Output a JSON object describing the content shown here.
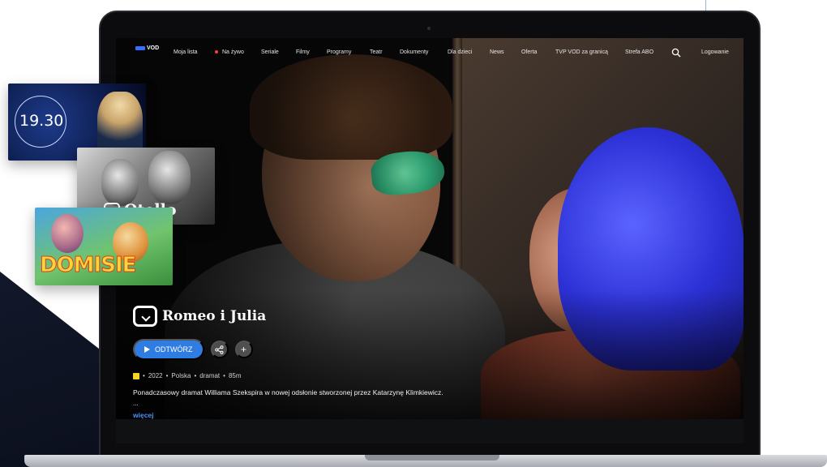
{
  "app": {
    "brand_logo_text": "VOD"
  },
  "nav": {
    "items": [
      {
        "label": "Moja lista"
      },
      {
        "label": "Na żywo"
      },
      {
        "label": "Seriale"
      },
      {
        "label": "Filmy"
      },
      {
        "label": "Programy"
      },
      {
        "label": "Teatr"
      },
      {
        "label": "Dokumenty"
      },
      {
        "label": "Dla dzieci"
      },
      {
        "label": "News"
      },
      {
        "label": "Oferta"
      },
      {
        "label": "TVP VOD za granicą"
      },
      {
        "label": "Strefa ABO"
      }
    ],
    "login_label": "Logowanie",
    "search_icon": "search-icon",
    "live_dot_color": "#ff3b3b"
  },
  "hero": {
    "title": "Romeo i Julia",
    "play_label": "ODTWÓRZ",
    "share_icon": "share-icon",
    "add_icon": "plus-icon",
    "meta": [
      "2022",
      "Polska",
      "dramat",
      "85m"
    ],
    "description": "Ponadczasowy dramat Williama Szekspira w nowej odsłonie stworzonej przez Katarzynę Klimkiewicz.",
    "ellipsis": "...",
    "more_label": "więcej",
    "accent_color": "#2f7de2",
    "link_color": "#4c95ff"
  },
  "cards": {
    "news_time": "19.30",
    "otello_title": "Otello",
    "domisie_title": "DOMISIE"
  }
}
